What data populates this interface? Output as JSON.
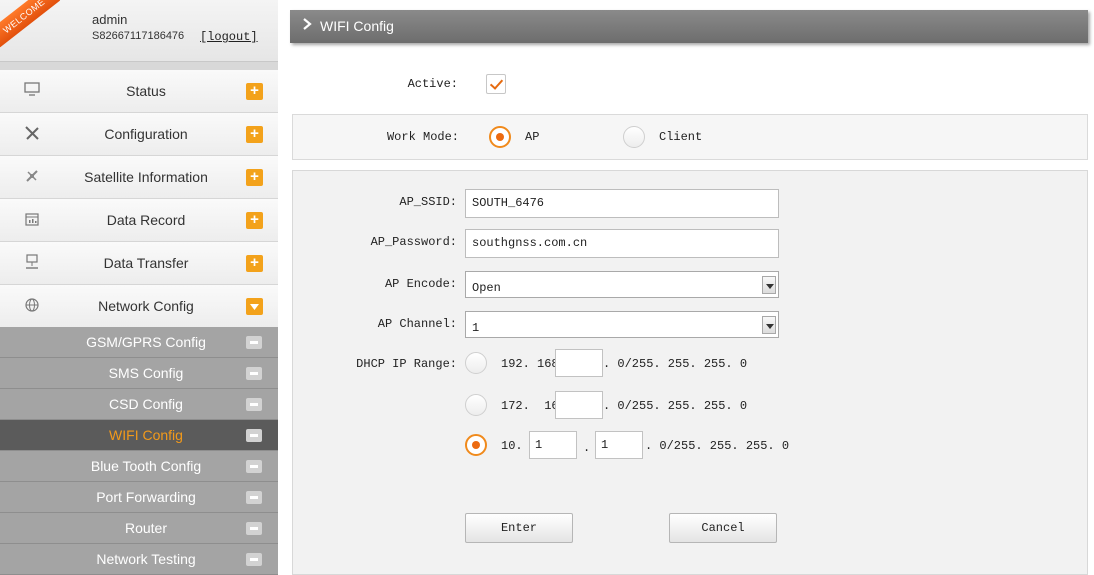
{
  "user": {
    "welcome_badge": "WELCOME",
    "name": "admin",
    "serial": "S82667117186476",
    "logout_label": "[logout]"
  },
  "menu": {
    "items": [
      {
        "label": "Status",
        "icon": "monitor-icon"
      },
      {
        "label": "Configuration",
        "icon": "tools-icon"
      },
      {
        "label": "Satellite Information",
        "icon": "satellite-icon"
      },
      {
        "label": "Data Record",
        "icon": "calendar-icon"
      },
      {
        "label": "Data Transfer",
        "icon": "network-icon"
      },
      {
        "label": "Network Config",
        "icon": "globe-icon"
      }
    ],
    "network_submenu": [
      {
        "label": "GSM/GPRS Config"
      },
      {
        "label": "SMS Config"
      },
      {
        "label": "CSD Config"
      },
      {
        "label": "WIFI Config",
        "active": true
      },
      {
        "label": "Blue Tooth Config"
      },
      {
        "label": "Port Forwarding"
      },
      {
        "label": "Router"
      },
      {
        "label": "Network Testing"
      }
    ]
  },
  "page": {
    "title": "WIFI Config"
  },
  "form": {
    "active_label": "Active:",
    "active_checked": true,
    "work_mode_label": "Work Mode:",
    "work_mode_options": [
      "AP",
      "Client"
    ],
    "work_mode_selected": "AP",
    "ap_ssid_label": "AP_SSID:",
    "ap_ssid_value": "SOUTH_6476",
    "ap_password_label": "AP_Password:",
    "ap_password_value": "southgnss.com.cn",
    "ap_encode_label": "AP Encode:",
    "ap_encode_value": "Open",
    "ap_channel_label": "AP Channel:",
    "ap_channel_value": "1",
    "dhcp_label": "DHCP IP Range:",
    "dhcp_options": [
      {
        "prefix": "192. 168.",
        "octet1": "",
        "suffix": ". 0/255. 255. 255. 0",
        "selected": false
      },
      {
        "prefix": "172.  16.",
        "octet1": "",
        "suffix": ". 0/255. 255. 255. 0",
        "selected": false
      },
      {
        "prefix": "10.",
        "octet1": "1",
        "dot": ".",
        "octet2": "1",
        "suffix": ". 0/255. 255. 255. 0",
        "selected": true
      }
    ],
    "enter_label": "Enter",
    "cancel_label": "Cancel"
  },
  "colors": {
    "accent": "#f39a1a",
    "radio_dot": "#ec6a10",
    "header_bg": "#7b7b7b",
    "submenu_bg": "#a4a4a4",
    "submenu_active_bg": "#5b5b5b"
  }
}
